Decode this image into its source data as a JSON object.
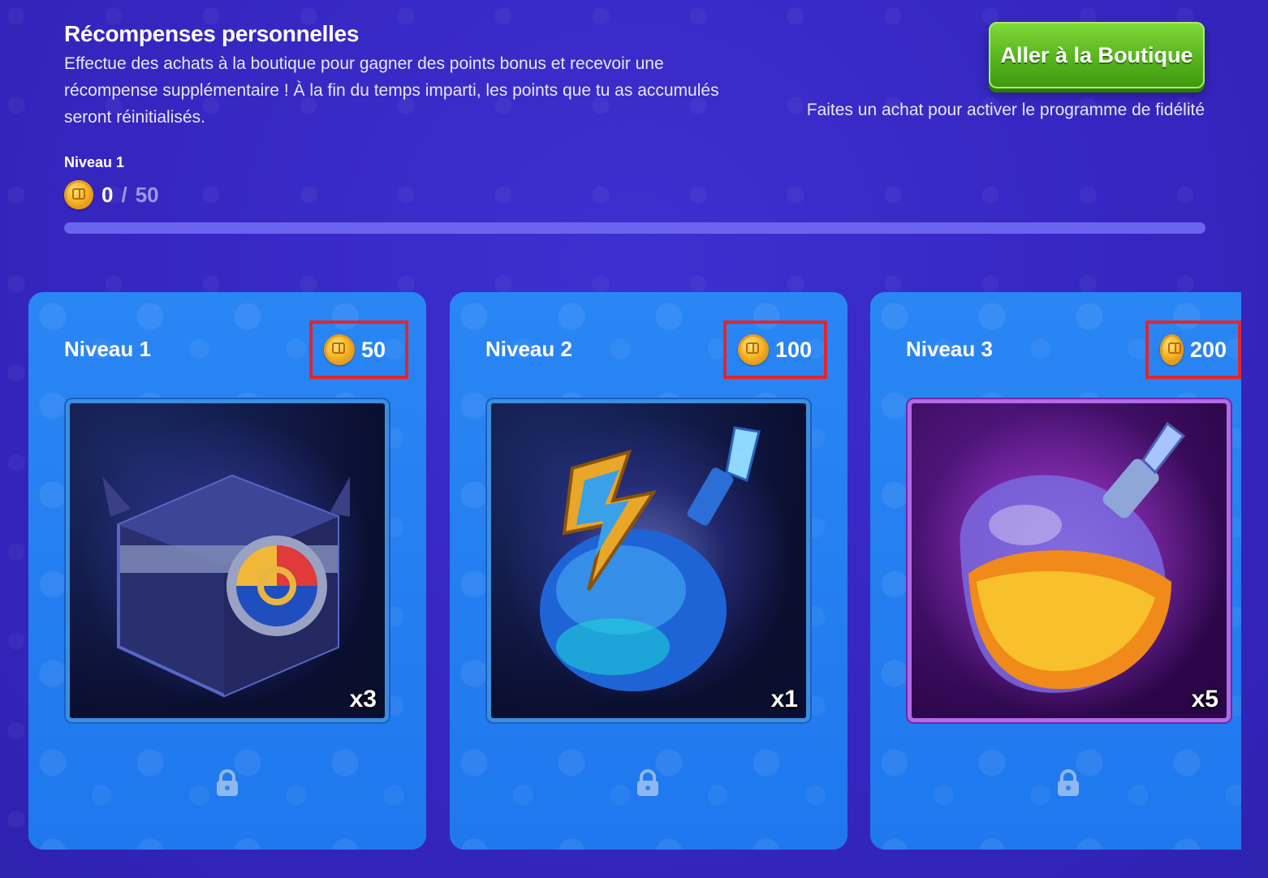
{
  "header": {
    "title": "Récompenses personnelles",
    "description": "Effectue des achats à la boutique pour gagner des points bonus et recevoir une récompense supplémentaire ! À la fin du temps imparti, les points que tu as accumulés seront réinitialisés.",
    "shop_button": "Aller à la Boutique",
    "fidelity_text": "Faites un achat pour activer le programme de fidélité"
  },
  "progress": {
    "level_label": "Niveau 1",
    "current": "0",
    "separator": "/",
    "total": "50",
    "fraction": 0
  },
  "rewards": [
    {
      "level": "Niveau 1",
      "cost": "50",
      "quantity": "x3",
      "item_icon": "mystery-cube-icon",
      "locked": true
    },
    {
      "level": "Niveau 2",
      "cost": "100",
      "quantity": "x1",
      "item_icon": "lightning-potion-icon",
      "locked": true
    },
    {
      "level": "Niveau 3",
      "cost": "200",
      "quantity": "x5",
      "item_icon": "orange-elixir-icon",
      "locked": true
    }
  ],
  "colors": {
    "background": "#3a2cc6",
    "card": "#2a86f4",
    "shop_button": "#57b41e",
    "highlight_border": "#e3252b",
    "coin": "#f5b524"
  }
}
